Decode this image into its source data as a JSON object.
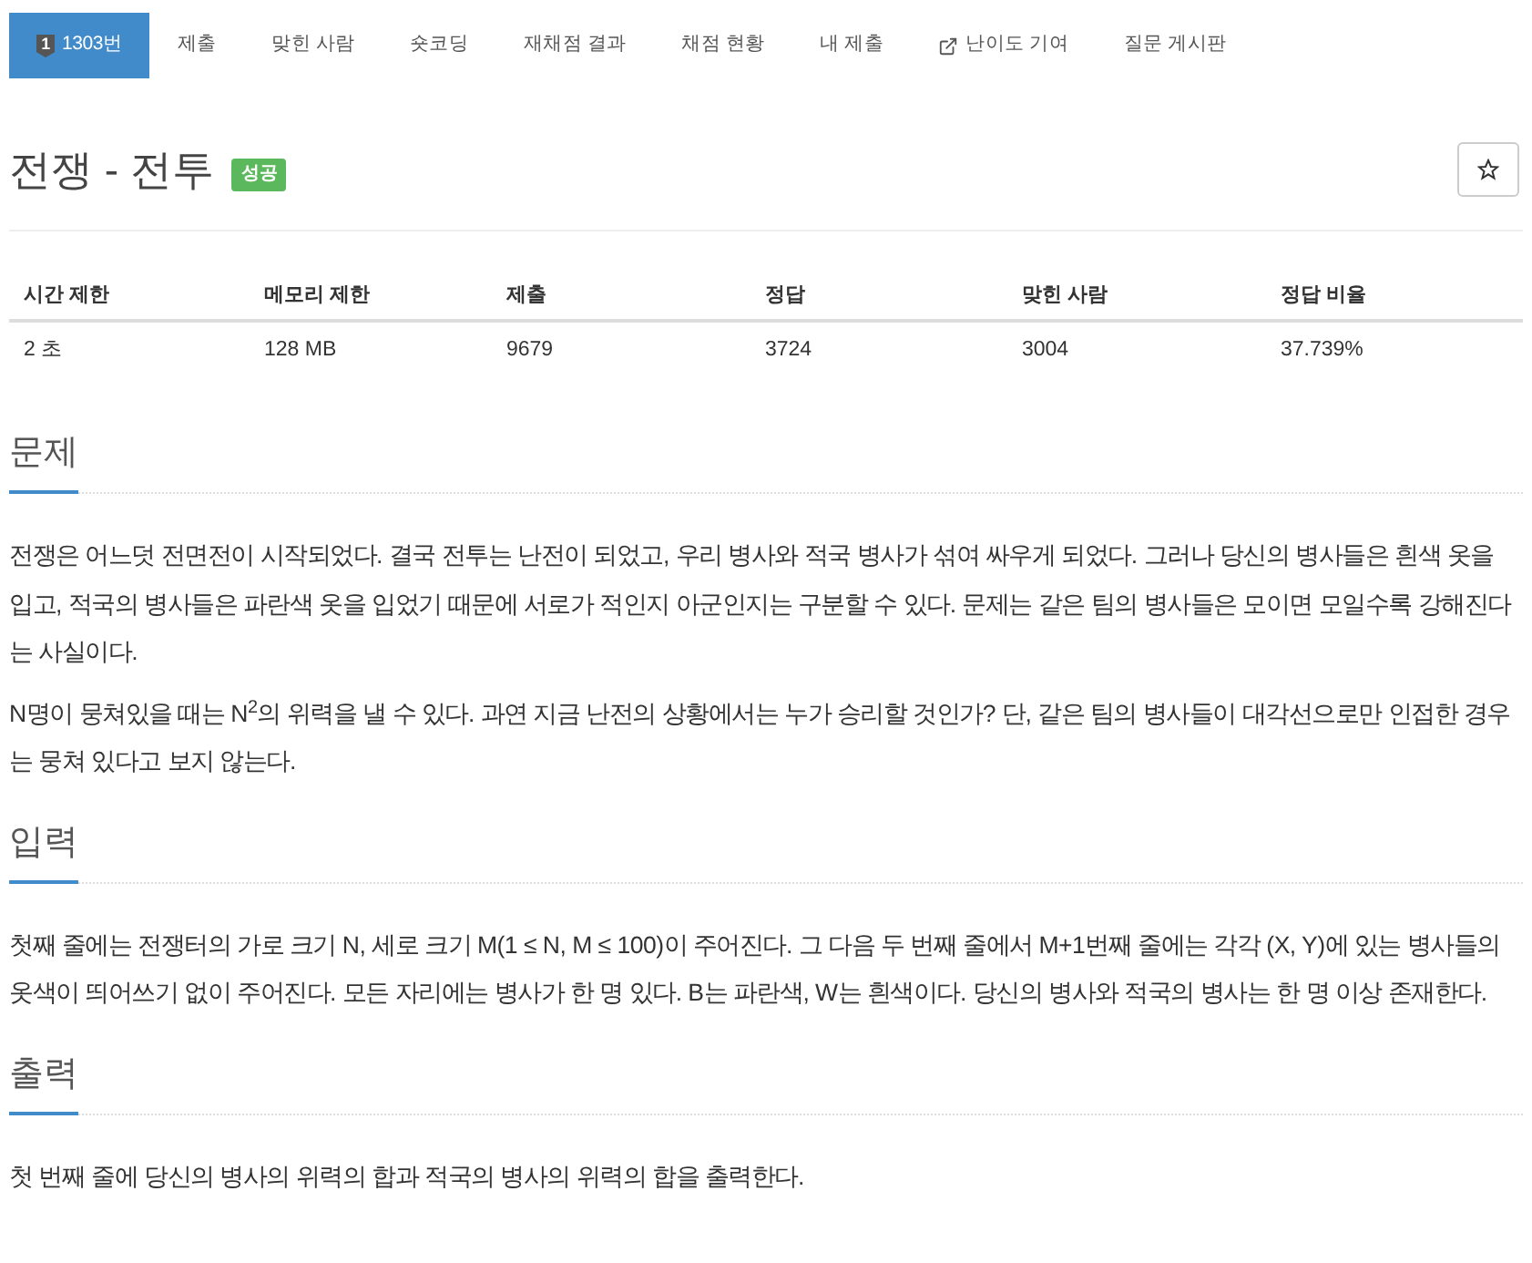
{
  "nav_tabs": [
    {
      "kind": "problem",
      "badge": "1",
      "label": "1303번",
      "selected": true
    },
    {
      "kind": "plain",
      "label": "제출",
      "selected": false
    },
    {
      "kind": "plain",
      "label": "맞힌 사람",
      "selected": false
    },
    {
      "kind": "plain",
      "label": "숏코딩",
      "selected": false
    },
    {
      "kind": "plain",
      "label": "재채점 결과",
      "selected": false
    },
    {
      "kind": "plain",
      "label": "채점 현황",
      "selected": false
    },
    {
      "kind": "plain",
      "label": "내 제출",
      "selected": false
    },
    {
      "kind": "external",
      "label": "난이도 기여",
      "selected": false
    },
    {
      "kind": "plain",
      "label": "질문 게시판",
      "selected": false
    }
  ],
  "problem": {
    "title": "전쟁 - 전투",
    "status_badge": "성공"
  },
  "stats_table": {
    "columns": [
      "시간 제한",
      "메모리 제한",
      "제출",
      "정답",
      "맞힌 사람",
      "정답 비율"
    ],
    "rows": [
      [
        "2 초",
        "128 MB",
        "9679",
        "3724",
        "3004",
        "37.739%"
      ]
    ]
  },
  "sections": [
    {
      "heading": "문제",
      "paragraphs": [
        "전쟁은 어느덧 전면전이 시작되었다. 결국 전투는 난전이 되었고, 우리 병사와 적국 병사가 섞여 싸우게 되었다. 그러나 당신의 병사들은 흰색 옷을 입고, 적국의 병사들은 파란색 옷을 입었기 때문에 서로가 적인지 아군인지는 구분할 수 있다. 문제는 같은 팀의 병사들은 모이면 모일수록 강해진다는 사실이다.",
        "N명이 뭉쳐있을 때는 N$^{2}$의 위력을 낼 수 있다. 과연 지금 난전의 상황에서는 누가 승리할 것인가? 단, 같은 팀의 병사들이 대각선으로만 인접한 경우는 뭉쳐 있다고 보지 않는다."
      ]
    },
    {
      "heading": "입력",
      "paragraphs": [
        "첫째 줄에는 전쟁터의 가로 크기 N, 세로 크기 M(1 ≤ N, M ≤ 100)이 주어진다. 그 다음 두 번째 줄에서 M+1번째 줄에는 각각 (X, Y)에 있는 병사들의 옷색이 띄어쓰기 없이 주어진다. 모든 자리에는 병사가 한 명 있다. B는 파란색, W는 흰색이다. 당신의 병사와 적국의 병사는 한 명 이상 존재한다."
      ]
    },
    {
      "heading": "출력",
      "paragraphs": [
        "첫 번째 줄에 당신의 병사의 위력의 합과 적국의 병사의 위력의 합을 출력한다."
      ]
    }
  ]
}
